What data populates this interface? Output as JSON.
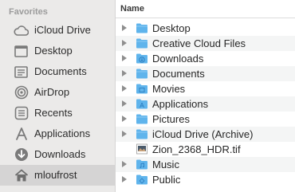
{
  "sidebar": {
    "section_title": "Favorites",
    "items": [
      {
        "label": "iCloud Drive",
        "icon": "cloud-icon"
      },
      {
        "label": "Desktop",
        "icon": "desktop-icon"
      },
      {
        "label": "Documents",
        "icon": "documents-icon"
      },
      {
        "label": "AirDrop",
        "icon": "airdrop-icon"
      },
      {
        "label": "Recents",
        "icon": "clock-icon"
      },
      {
        "label": "Applications",
        "icon": "applications-icon"
      },
      {
        "label": "Downloads",
        "icon": "download-icon"
      },
      {
        "label": "mloufrost",
        "icon": "home-icon",
        "selected": true
      }
    ]
  },
  "list": {
    "column_header": "Name",
    "rows": [
      {
        "label": "Desktop",
        "kind": "folder",
        "expandable": true
      },
      {
        "label": "Creative Cloud Files",
        "kind": "folder",
        "expandable": true
      },
      {
        "label": "Downloads",
        "kind": "folder-downloads",
        "expandable": true
      },
      {
        "label": "Documents",
        "kind": "folder",
        "expandable": true
      },
      {
        "label": "Movies",
        "kind": "folder-movies",
        "expandable": true
      },
      {
        "label": "Applications",
        "kind": "folder-applications",
        "expandable": true
      },
      {
        "label": "Pictures",
        "kind": "folder",
        "expandable": true
      },
      {
        "label": "iCloud Drive (Archive)",
        "kind": "folder",
        "expandable": true
      },
      {
        "label": "Zion_2368_HDR.tif",
        "kind": "image-file",
        "expandable": false
      },
      {
        "label": "Music",
        "kind": "folder-music",
        "expandable": true
      },
      {
        "label": "Public",
        "kind": "folder-public",
        "expandable": true
      }
    ]
  },
  "colors": {
    "sidebar_bg": "#ebeae9",
    "folder_blue": "#5fb4ec",
    "icon_gray": "#7a7a7a",
    "selected_bg": "#d5d4d4"
  }
}
